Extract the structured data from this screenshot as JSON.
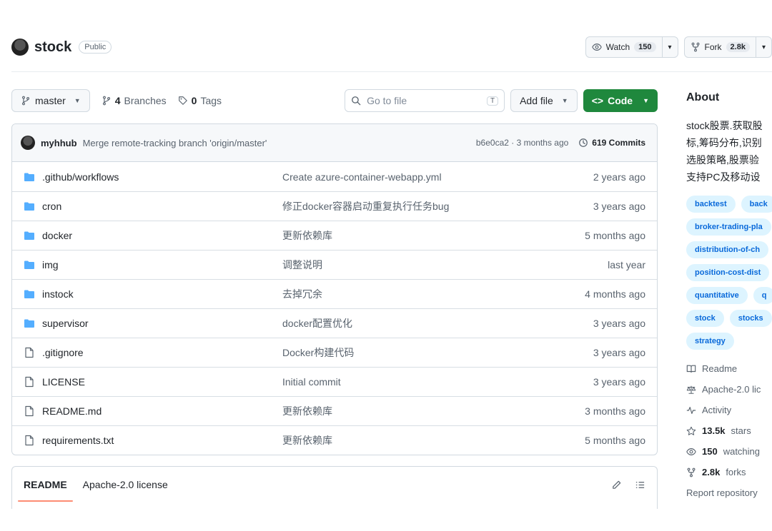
{
  "repo": {
    "name": "stock",
    "visibility": "Public"
  },
  "actions": {
    "watch_label": "Watch",
    "watch_count": "150",
    "fork_label": "Fork",
    "fork_count": "2.8k"
  },
  "toolbar": {
    "branch": "master",
    "branches_count": "4",
    "branches_label": "Branches",
    "tags_count": "0",
    "tags_label": "Tags",
    "search_placeholder": "Go to file",
    "search_kbd": "T",
    "add_file_label": "Add file",
    "code_label": "Code"
  },
  "latest_commit": {
    "author": "myhhub",
    "message": "Merge remote-tracking branch 'origin/master'",
    "meta": "b6e0ca2 · 3 months ago",
    "commits_label": "619 Commits"
  },
  "files": [
    {
      "type": "dir",
      "name": ".github/workflows",
      "message": "Create azure-container-webapp.yml",
      "date": "2 years ago"
    },
    {
      "type": "dir",
      "name": "cron",
      "message": "修正docker容器启动重复执行任务bug",
      "date": "3 years ago"
    },
    {
      "type": "dir",
      "name": "docker",
      "message": "更新依赖库",
      "date": "5 months ago"
    },
    {
      "type": "dir",
      "name": "img",
      "message": "调整说明",
      "date": "last year"
    },
    {
      "type": "dir",
      "name": "instock",
      "message": "去掉冗余",
      "date": "4 months ago"
    },
    {
      "type": "dir",
      "name": "supervisor",
      "message": "docker配置优化",
      "date": "3 years ago"
    },
    {
      "type": "file",
      "name": ".gitignore",
      "message": "Docker构建代码",
      "date": "3 years ago"
    },
    {
      "type": "file",
      "name": "LICENSE",
      "message": "Initial commit",
      "date": "3 years ago"
    },
    {
      "type": "file",
      "name": "README.md",
      "message": "更新依赖库",
      "date": "3 months ago"
    },
    {
      "type": "file",
      "name": "requirements.txt",
      "message": "更新依赖库",
      "date": "5 months ago"
    }
  ],
  "readme": {
    "tab_readme": "README",
    "tab_license": "Apache-2.0 license"
  },
  "about": {
    "title": "About",
    "description_lines": [
      "stock股票.获取股",
      "标,筹码分布,识别",
      "选股策略,股票验",
      "支持PC及移动设"
    ],
    "topics": [
      "backtest",
      "back",
      "broker-trading-pla",
      "distribution-of-ch",
      "position-cost-dist",
      "quantitative",
      "q",
      "stock",
      "stocks",
      "strategy"
    ],
    "readme_label": "Readme",
    "license_label": "Apache-2.0 lic",
    "activity_label": "Activity",
    "stars_count": "13.5k",
    "stars_label": "stars",
    "watching_count": "150",
    "watching_label": "watching",
    "forks_count": "2.8k",
    "forks_label": "forks",
    "report_label": "Report repository"
  },
  "colors": {
    "accent_green": "#1f883d",
    "folder_blue": "#54aeff",
    "link_blue": "#0969da",
    "topic_bg": "#ddf4ff"
  }
}
